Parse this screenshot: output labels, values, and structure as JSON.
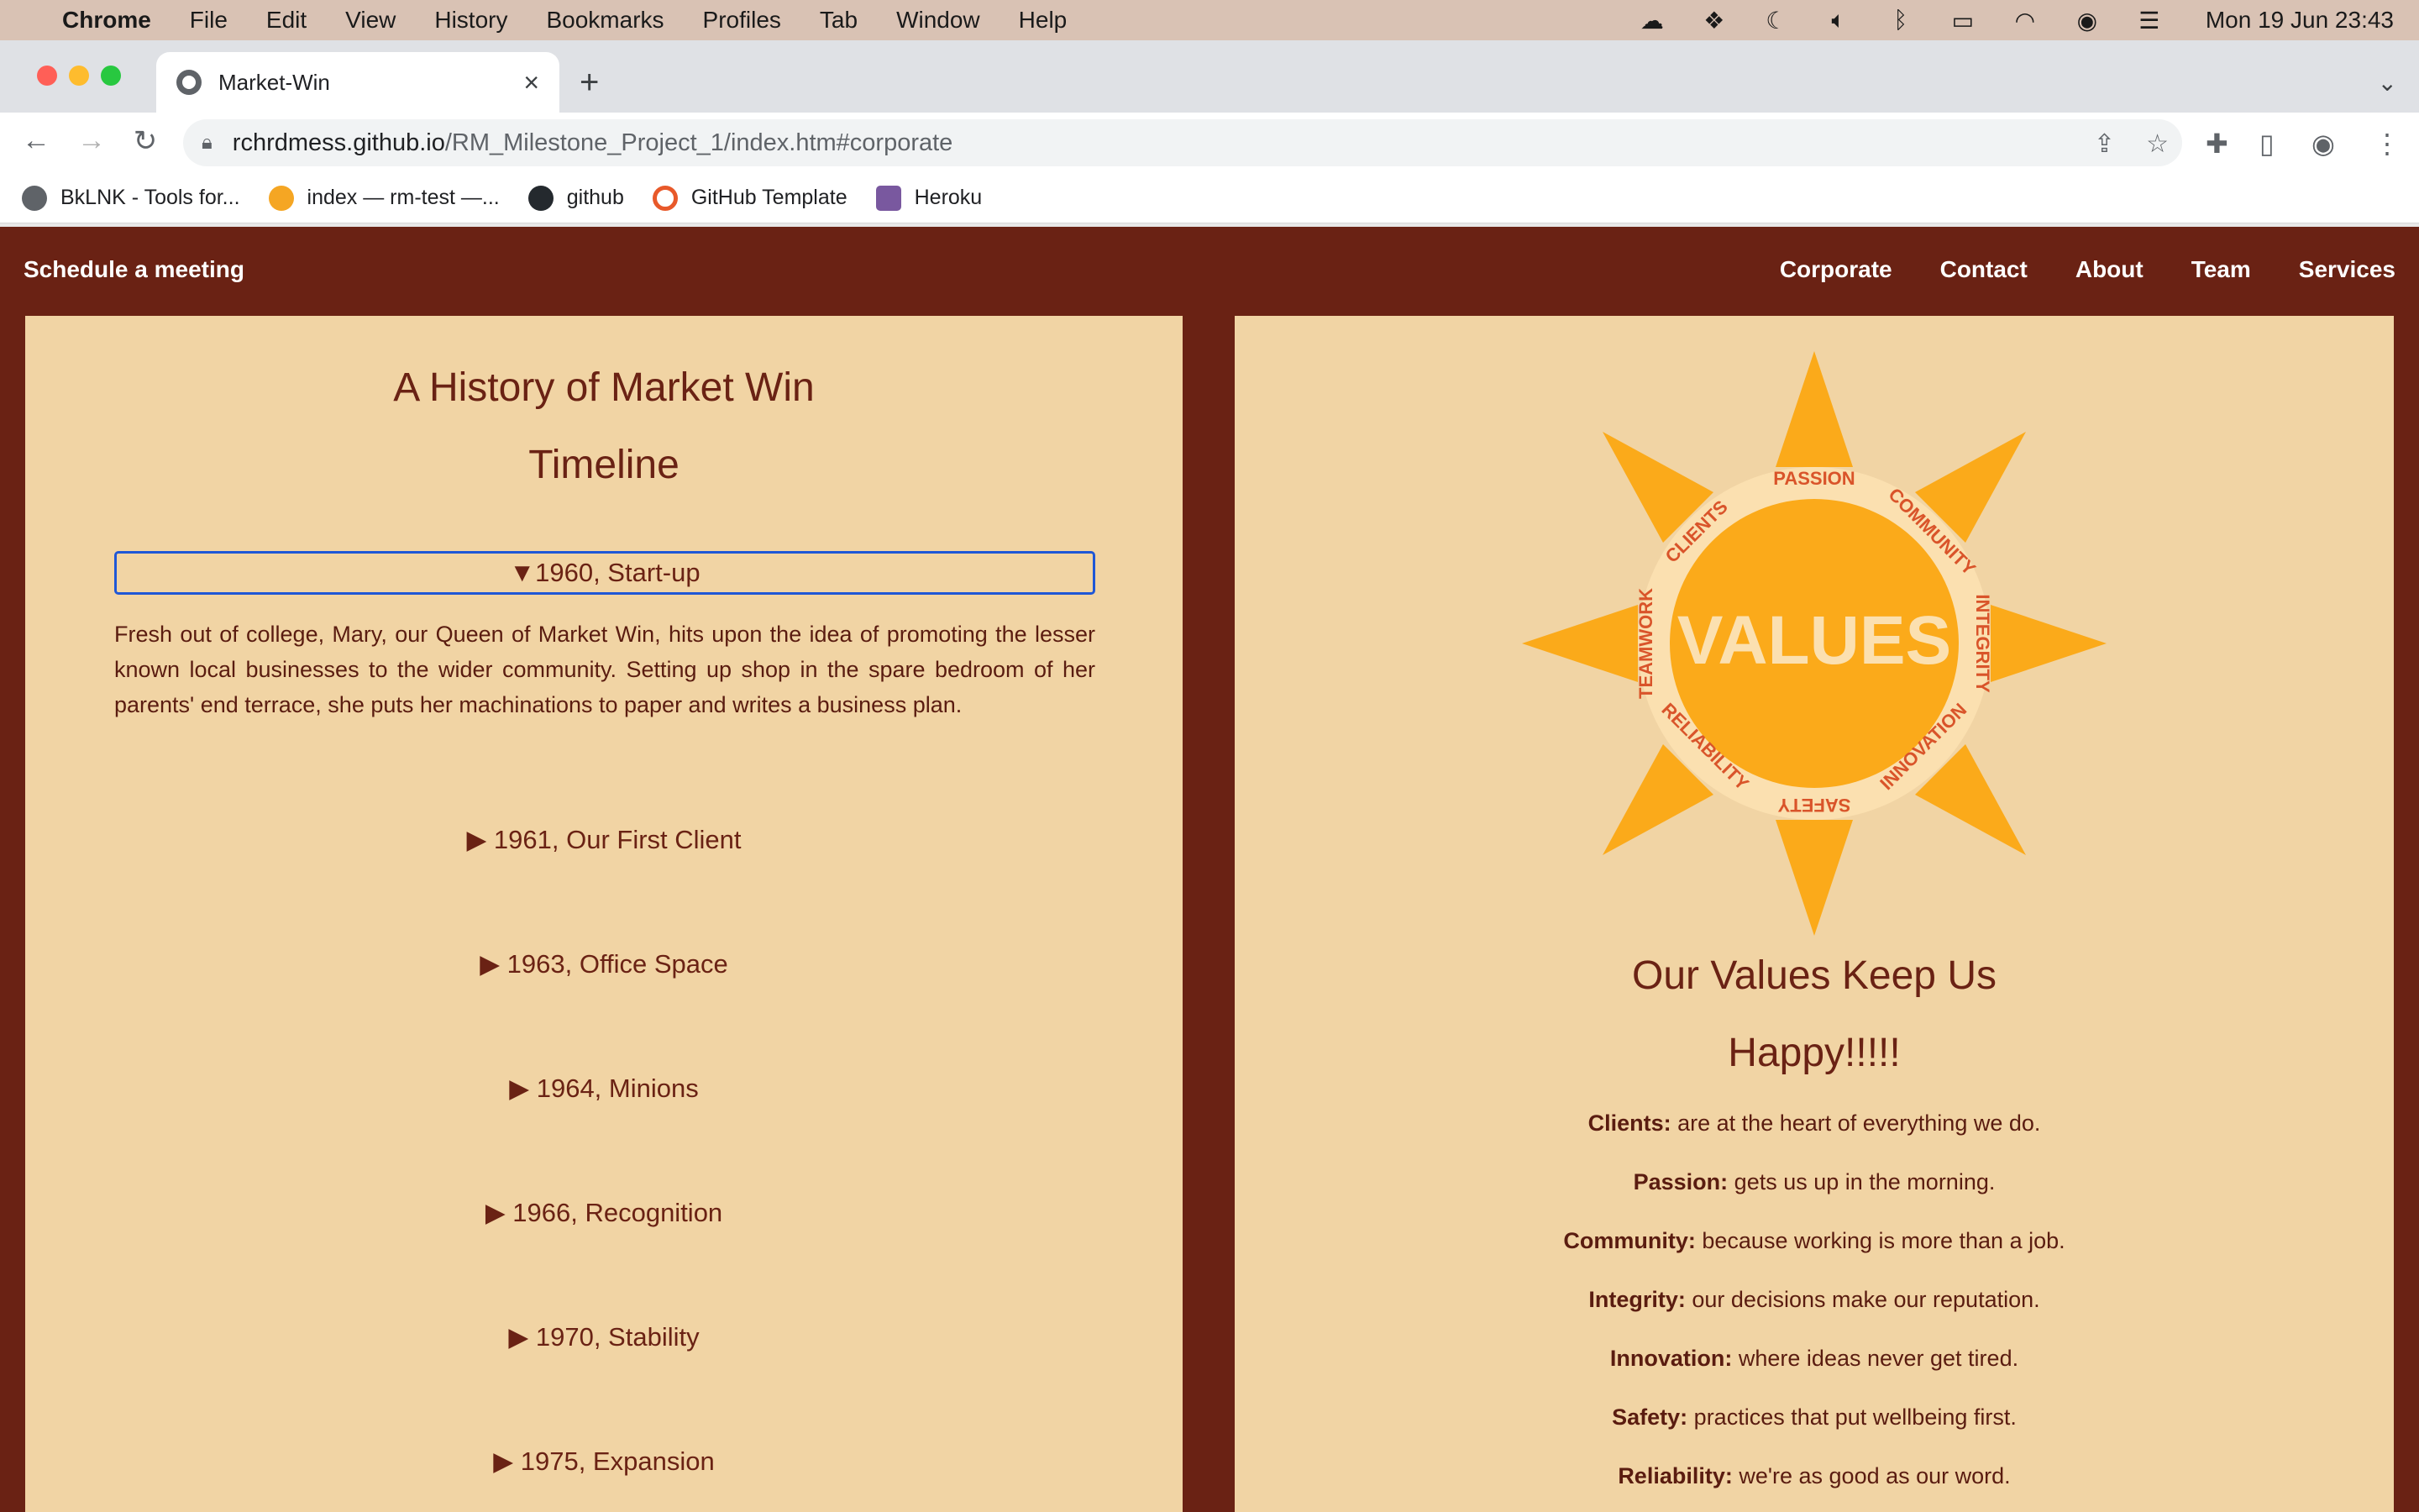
{
  "os": {
    "menubar": {
      "app_name": "Chrome",
      "items": [
        "File",
        "Edit",
        "View",
        "History",
        "Bookmarks",
        "Profiles",
        "Tab",
        "Window",
        "Help"
      ],
      "clock": "Mon 19 Jun  23:43"
    }
  },
  "browser": {
    "tab_title": "Market-Win",
    "url_host": "rchrdmess.github.io",
    "url_path": "/RM_Milestone_Project_1/index.htm#corporate",
    "bookmarks": [
      {
        "label": "BkLNK - Tools for...",
        "color": "#5f6368"
      },
      {
        "label": "index — rm-test —...",
        "color": "#f5a623"
      },
      {
        "label": "github",
        "color": "#24292e"
      },
      {
        "label": "GitHub Template",
        "color": "#e8592a"
      },
      {
        "label": "Heroku",
        "color": "#79589f"
      }
    ]
  },
  "site": {
    "nav": {
      "brand": "Schedule a meeting",
      "links": [
        "Corporate",
        "Contact",
        "About",
        "Team",
        "Services"
      ]
    },
    "history": {
      "title_line1": "A History of Market Win",
      "title_line2": "Timeline",
      "open_item": "▼1960, Start-up",
      "open_text": "Fresh out of college, Mary, our Queen of Market Win, hits upon the idea of promoting the lesser known local businesses to the wider community. Setting up shop in the spare bedroom of her parents' end terrace, she puts her machinations to paper and writes a business plan.",
      "items": [
        "▶ 1961, Our First Client",
        "▶ 1963, Office Space",
        "▶ 1964, Minions",
        "▶ 1966, Recognition",
        "▶ 1970, Stability",
        "▶ 1975, Expansion"
      ]
    },
    "values": {
      "image_center": "VALUES",
      "image_words": [
        "PASSION",
        "COMMUNITY",
        "INTEGRITY",
        "INNOVATION",
        "SAFETY",
        "RELIABILITY",
        "TEAMWORK",
        "CLIENTS"
      ],
      "title_line1": "Our Values Keep Us",
      "title_line2": "Happy!!!!!",
      "lines": [
        {
          "term": "Clients:",
          "text": " are at the heart of everything we do."
        },
        {
          "term": "Passion:",
          "text": " gets us up in the morning."
        },
        {
          "term": "Community:",
          "text": " because working is more than a job."
        },
        {
          "term": "Integrity:",
          "text": " our decisions make our reputation."
        },
        {
          "term": "Innovation:",
          "text": " where ideas never get tired."
        },
        {
          "term": "Safety:",
          "text": " practices that put wellbeing first."
        },
        {
          "term": "Reliability:",
          "text": " we're as good as our word."
        }
      ]
    },
    "colors": {
      "brand_dark": "#6a2214",
      "panel_bg": "#f1d4a4",
      "sun": "#fbaa1a"
    }
  }
}
